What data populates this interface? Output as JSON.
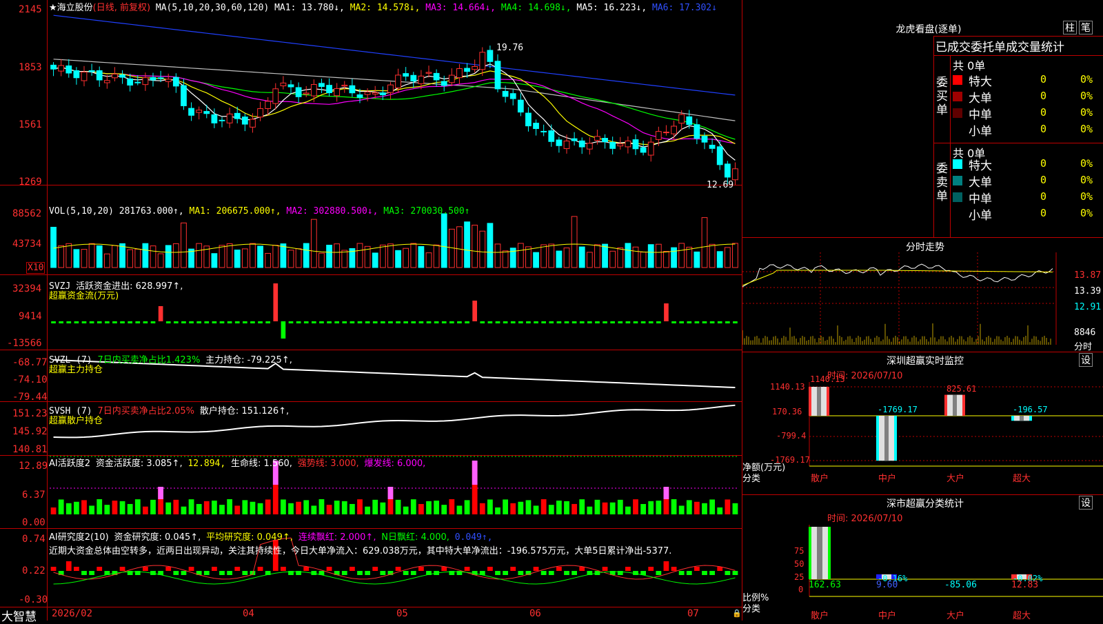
{
  "app": {
    "brand": "大智慧",
    "stock_title": "★海立股份",
    "period": "(日线, 前复权)"
  },
  "main_chart": {
    "ma_params": "MA(5,10,20,30,60,120)",
    "ma1": "MA1: 13.780↓,",
    "ma2": "MA2: 14.578↓,",
    "ma3": "MA3: 14.664↓,",
    "ma4": "MA4: 14.698↓,",
    "ma5": "MA5: 16.223↓,",
    "ma6": "MA6: 17.302↓",
    "y_labels": [
      "2145",
      "1853",
      "1561",
      "1269"
    ],
    "high_mark": "19.76",
    "low_mark": "12.69"
  },
  "vol_panel": {
    "params": "VOL(5,10,20)",
    "value": "281763.000↑,",
    "ma1": "MA1: 206675.000↑,",
    "ma2": "MA2: 302880.500↓,",
    "ma3": "MA3: 270030.500↑",
    "y_labels": [
      "88562",
      "43734"
    ],
    "unit": "X10"
  },
  "svzj_panel": {
    "name": "SVZJ",
    "line1": "活跃资金进出: 628.997↑,",
    "line2": "超赢资金流(万元)",
    "y_labels": [
      "32394",
      "9414",
      "-13566"
    ]
  },
  "svzl_panel": {
    "name": "SVZL (7)",
    "ratio": "7日内买卖净占比1.423%",
    "value": "主力持仓: -79.225↑,",
    "line2": "超赢主力持仓",
    "y_labels": [
      "-68.77",
      "-74.10",
      "-79.44"
    ]
  },
  "svsh_panel": {
    "name": "SVSH (7)",
    "ratio": "7日内买卖净占比2.05%",
    "value": "散户持仓: 151.126↑,",
    "line2": "超赢散户持仓",
    "y_labels": [
      "151.23",
      "145.92",
      "140.81"
    ]
  },
  "ai_active_panel": {
    "name": "AI活跃度2",
    "v1": "资金活跃度: 3.085↑,",
    "v2": "12.894,",
    "v3": "生命线: 1.560,",
    "v4": "强势线: 3.000,",
    "v5": "爆发线: 6.000,",
    "y_labels": [
      "12.89",
      "6.37",
      "0.00"
    ]
  },
  "ai_research_panel": {
    "name": "AI研究度2(10)",
    "v1": "资金研究度: 0.045↑,",
    "v2": "平均研究度: 0.049↑,",
    "v3": "连续飘红: 2.000↑,",
    "v4": "N日飘红: 4.000,",
    "v5": "0.049↑,",
    "comment": "近期大资金总体由空转多，近两日出现异动，关注其持续性，今日大单净流入：629.038万元，其中特大单净流出：-196.575万元，大单5日累计净出-5377.",
    "y_labels": [
      "0.74",
      "0.22",
      "-0.30"
    ]
  },
  "x_axis": {
    "labels": [
      "2026/02",
      "04",
      "05",
      "06",
      "07"
    ]
  },
  "dragon_tiger": {
    "title": "龙虎看盘(逐单)",
    "btn_bar": "柱",
    "btn_pen": "笔",
    "header": "已成交委托单成交量统计",
    "buy_label": "委买单",
    "sell_label": "委卖单",
    "buy_total": "共 0单",
    "sell_total": "共 0单",
    "buy_rows": [
      {
        "label": "特大",
        "count": "0",
        "pct": "0%",
        "color": "#ff0000"
      },
      {
        "label": "大单",
        "count": "0",
        "pct": "0%",
        "color": "#a00000"
      },
      {
        "label": "中单",
        "count": "0",
        "pct": "0%",
        "color": "#600000"
      },
      {
        "label": "小单",
        "count": "0",
        "pct": "0%",
        "color": "#000000"
      }
    ],
    "sell_rows": [
      {
        "label": "特大",
        "count": "0",
        "pct": "0%",
        "color": "#00ffff"
      },
      {
        "label": "大单",
        "count": "0",
        "pct": "0%",
        "color": "#008080"
      },
      {
        "label": "中单",
        "count": "0",
        "pct": "0%",
        "color": "#006060"
      },
      {
        "label": "小单",
        "count": "0",
        "pct": "0%",
        "color": "#000000"
      }
    ]
  },
  "intraday": {
    "title": "分时走势",
    "y_labels": [
      "13.87",
      "13.39",
      "12.91"
    ],
    "vol_label": "8846",
    "vol_unit": "分时"
  },
  "sz_monitor": {
    "title": "深圳超赢实时监控",
    "btn": "设",
    "time": "时间: 2026/07/10",
    "y_labels": [
      "1140.13",
      "170.36",
      "-799.4",
      "-1769.17"
    ],
    "unit_label": "净额(万元)",
    "cat_label": "分类",
    "categories": [
      "散户",
      "中户",
      "大户",
      "超大"
    ],
    "values": [
      1140.13,
      -1769.17,
      825.61,
      -196.57
    ],
    "value_labels": [
      "1140.13",
      "-1769.17",
      "825.61",
      "-196.57"
    ]
  },
  "sz_class": {
    "title": "深市超赢分类统计",
    "btn": "设",
    "time": "时间: 2026/07/10",
    "y_labels": [
      "75",
      "50",
      "25",
      "0"
    ],
    "unit_label": "比例%",
    "cat_label": "分类",
    "categories": [
      "散户",
      "中户",
      "大户",
      "超大"
    ],
    "values": [
      162.63,
      9.6,
      -85.06,
      12.83
    ],
    "pct_labels": [
      "-0.16%",
      "-0.02%"
    ]
  },
  "colors": {
    "border": "#c00000",
    "up": "#ff3030",
    "down": "#00ffff",
    "green_bar": "#00ff00"
  }
}
